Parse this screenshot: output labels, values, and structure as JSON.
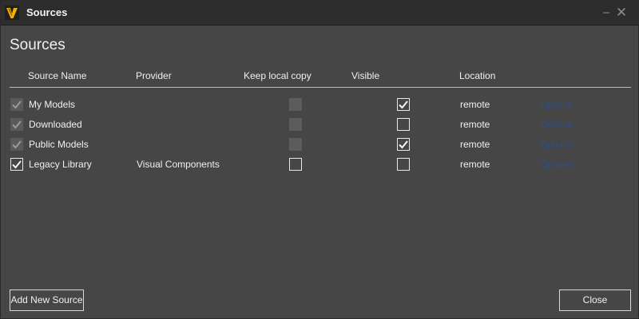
{
  "window": {
    "title": "Sources",
    "minimize_glyph": "–",
    "close_glyph": "✕"
  },
  "dialog": {
    "heading": "Sources"
  },
  "columns": {
    "source_name": "Source Name",
    "provider": "Provider",
    "keep_local_copy": "Keep local copy",
    "visible": "Visible",
    "location": "Location"
  },
  "rows": [
    {
      "enabled": true,
      "enabled_editable": false,
      "name": "My Models",
      "provider": "",
      "keep_local_copy": false,
      "keep_local_editable": false,
      "visible": true,
      "location": "remote",
      "options_label": "Options"
    },
    {
      "enabled": true,
      "enabled_editable": false,
      "name": "Downloaded",
      "provider": "",
      "keep_local_copy": false,
      "keep_local_editable": false,
      "visible": false,
      "location": "remote",
      "options_label": "Options"
    },
    {
      "enabled": true,
      "enabled_editable": false,
      "name": "Public Models",
      "provider": "",
      "keep_local_copy": false,
      "keep_local_editable": false,
      "visible": true,
      "location": "remote",
      "options_label": "Options"
    },
    {
      "enabled": true,
      "enabled_editable": true,
      "name": "Legacy Library",
      "provider": "Visual Components",
      "keep_local_copy": false,
      "keep_local_editable": true,
      "visible": false,
      "location": "remote",
      "options_label": "Options"
    }
  ],
  "footer": {
    "add_label": "Add New Source",
    "close_label": "Close"
  },
  "colors": {
    "background": "#464646",
    "titlebar": "#2d2d2d",
    "logo_accent": "#f0b400",
    "link": "#2f4f86"
  },
  "icons": {
    "app": "visual-components-logo-icon",
    "check": "checkmark-icon"
  }
}
